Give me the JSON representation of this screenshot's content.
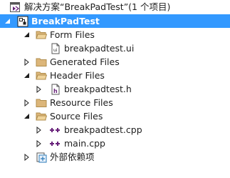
{
  "solution": {
    "label": "解决方案“BreakPadTest”(1 个项目)"
  },
  "project": {
    "label": "BreakPadTest"
  },
  "folders": {
    "form_files": "Form Files",
    "generated_files": "Generated Files",
    "header_files": "Header Files",
    "resource_files": "Resource Files",
    "source_files": "Source Files"
  },
  "files": {
    "ui": "breakpadtest.ui",
    "h": "breakpadtest.h",
    "cpp": "breakpadtest.cpp",
    "main": "main.cpp"
  },
  "external": {
    "label": "外部依赖项"
  },
  "colors": {
    "selection": "#3399ff",
    "folder": "#dcb67a",
    "cpp_icon": "#68217a"
  }
}
